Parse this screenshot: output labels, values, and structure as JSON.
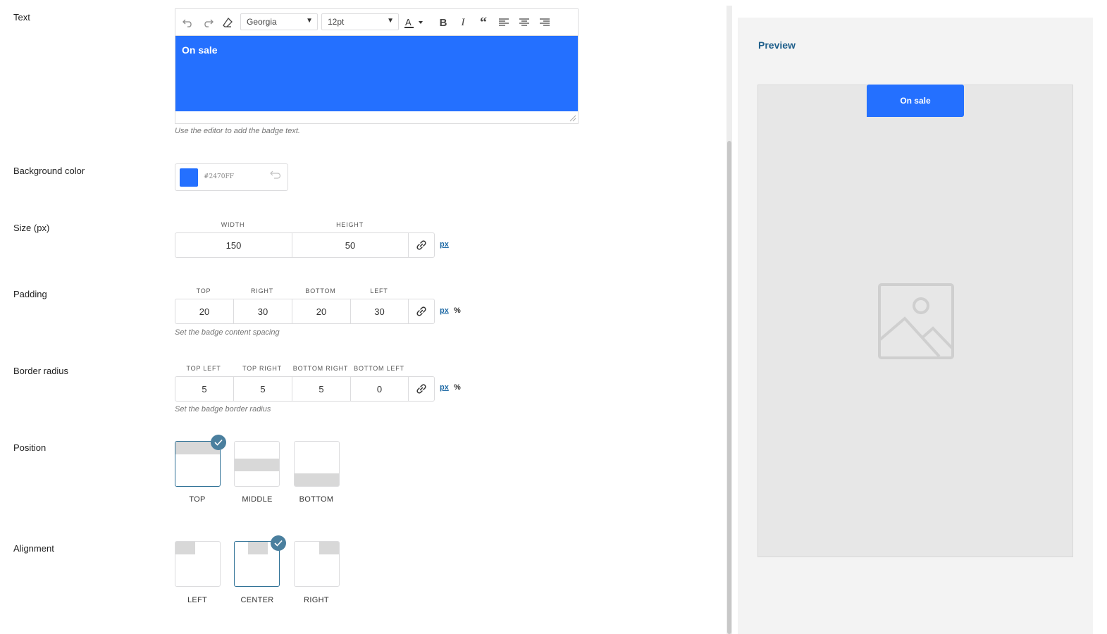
{
  "labels": {
    "text": "Text",
    "background_color": "Background color",
    "size": "Size (px)",
    "padding": "Padding",
    "border_radius": "Border radius",
    "position": "Position",
    "alignment": "Alignment"
  },
  "editor": {
    "font": "Georgia",
    "font_size": "12pt",
    "content": "On sale",
    "help": "Use the editor to add the badge text."
  },
  "background": {
    "hex": "#2470FF"
  },
  "size": {
    "width_label": "WIDTH",
    "height_label": "HEIGHT",
    "width": "150",
    "height": "50",
    "unit_px": "px"
  },
  "padding": {
    "top_label": "TOP",
    "right_label": "RIGHT",
    "bottom_label": "BOTTOM",
    "left_label": "LEFT",
    "top": "20",
    "right": "30",
    "bottom": "20",
    "left": "30",
    "unit_px": "px",
    "unit_pct": "%",
    "help": "Set the badge content spacing"
  },
  "radius": {
    "tl_label": "TOP LEFT",
    "tr_label": "TOP RIGHT",
    "br_label": "BOTTOM RIGHT",
    "bl_label": "BOTTOM LEFT",
    "tl": "5",
    "tr": "5",
    "br": "5",
    "bl": "0",
    "unit_px": "px",
    "unit_pct": "%",
    "help": "Set the badge border radius"
  },
  "position": {
    "top": "TOP",
    "middle": "MIDDLE",
    "bottom": "BOTTOM",
    "selected": "TOP"
  },
  "alignment": {
    "left": "LEFT",
    "center": "CENTER",
    "right": "RIGHT",
    "selected": "CENTER"
  },
  "preview": {
    "title": "Preview",
    "badge_text": "On sale"
  },
  "colors": {
    "accent": "#2470FF",
    "selected": "#2F7196",
    "link": "#1F6AA5"
  },
  "icons": [
    "undo-icon",
    "redo-icon",
    "eraser-icon",
    "text-color-icon",
    "bold-icon",
    "italic-icon",
    "blockquote-icon",
    "align-left-icon",
    "align-center-icon",
    "align-right-icon",
    "link-icon",
    "check-icon",
    "reset-icon",
    "image-placeholder-icon"
  ]
}
